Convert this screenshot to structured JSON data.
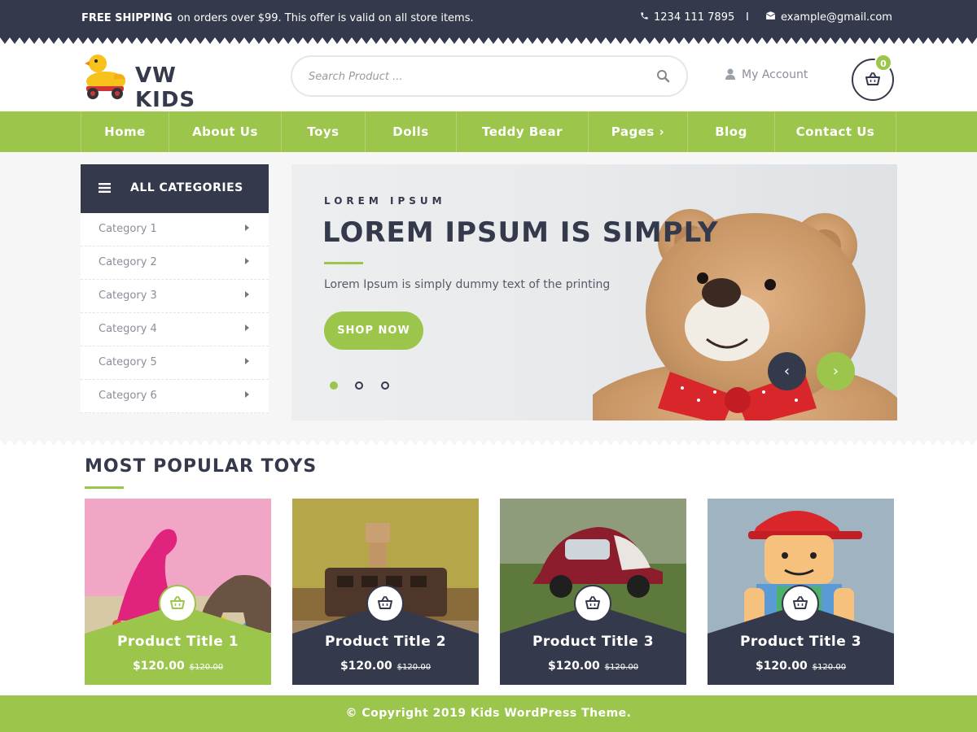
{
  "topbar": {
    "shipping_bold": "FREE SHIPPING",
    "shipping_text": "on orders over $99. This offer is valid on all store items.",
    "phone": "1234 111 7895",
    "separator": "I",
    "email": "example@gmail.com"
  },
  "header": {
    "logo_text": "VW KIDS",
    "search_placeholder": "Search Product ...",
    "account_label": "My Account",
    "cart_count": "0"
  },
  "nav": {
    "items": [
      {
        "label": "Home"
      },
      {
        "label": "About Us"
      },
      {
        "label": "Toys"
      },
      {
        "label": "Dolls"
      },
      {
        "label": "Teddy Bear"
      },
      {
        "label": "Pages ›"
      },
      {
        "label": "Blog"
      },
      {
        "label": "Contact Us"
      }
    ]
  },
  "categories": {
    "heading": "ALL CATEGORIES",
    "items": [
      "Category 1",
      "Category 2",
      "Category 3",
      "Category 4",
      "Category 5",
      "Category 6"
    ]
  },
  "slider": {
    "kicker": "LOREM IPSUM",
    "title": "LOREM IPSUM IS SIMPLY",
    "description": "Lorem Ipsum is simply dummy text of the printing",
    "button": "SHOP NOW",
    "prev": "‹",
    "next": "›",
    "active_slide": 1,
    "slide_count": 3
  },
  "popular": {
    "heading": "MOST POPULAR TOYS",
    "products": [
      {
        "title": "Product Title 1",
        "price": "$120.00",
        "old_price": "$120.00"
      },
      {
        "title": "Product Title 2",
        "price": "$120.00",
        "old_price": "$120.00"
      },
      {
        "title": "Product Title 3",
        "price": "$120.00",
        "old_price": "$120.00"
      },
      {
        "title": "Product Title 3",
        "price": "$120.00",
        "old_price": "$120.00"
      }
    ]
  },
  "footer": {
    "copyright": "© Copyright 2019 Kids WordPress Theme."
  },
  "colors": {
    "dark": "#343a4b",
    "accent": "#9bc54b"
  },
  "icons": {
    "phone": "phone-icon",
    "email": "envelope-icon",
    "search": "search-icon",
    "account": "user-icon",
    "cart": "basket-icon",
    "menu": "hamburger-icon"
  }
}
